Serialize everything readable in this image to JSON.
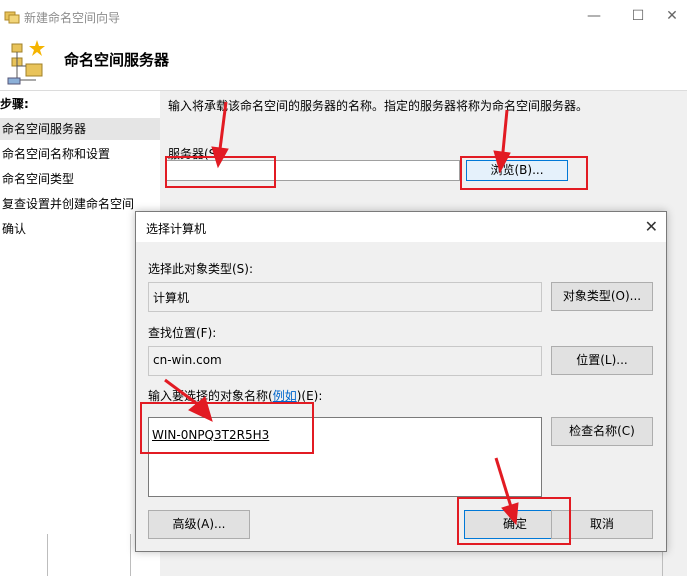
{
  "wizard": {
    "title": "新建命名空间向导",
    "header_title": "命名空间服务器",
    "steps_title": "步骤:",
    "steps": [
      {
        "label": "命名空间服务器"
      },
      {
        "label": "命名空间名称和设置"
      },
      {
        "label": "命名空间类型"
      },
      {
        "label": "复查设置并创建命名空间"
      },
      {
        "label": "确认"
      }
    ],
    "description": "输入将承载该命名空间的服务器的名称。指定的服务器将称为命名空间服务器。",
    "server_label": "服务器(S):",
    "server_value": "",
    "browse_label": "浏览(B)..."
  },
  "dialog": {
    "title": "选择计算机",
    "object_type_label": "选择此对象类型(S):",
    "object_type_value": "计算机",
    "object_type_button": "对象类型(O)...",
    "location_label": "查找位置(F):",
    "location_value": "cn-win.com",
    "location_button": "位置(L)...",
    "name_label_prefix": "输入要选择的对象名称(",
    "name_label_link": "例如",
    "name_label_suffix": ")(E):",
    "name_value": "WIN-0NPQ3T2R5H3",
    "check_names_button": "检查名称(C)",
    "advanced_button": "高级(A)...",
    "ok_button": "确定",
    "cancel_button": "取消"
  },
  "colors": {
    "annotation": "#e21b23",
    "accent": "#0078d7"
  }
}
